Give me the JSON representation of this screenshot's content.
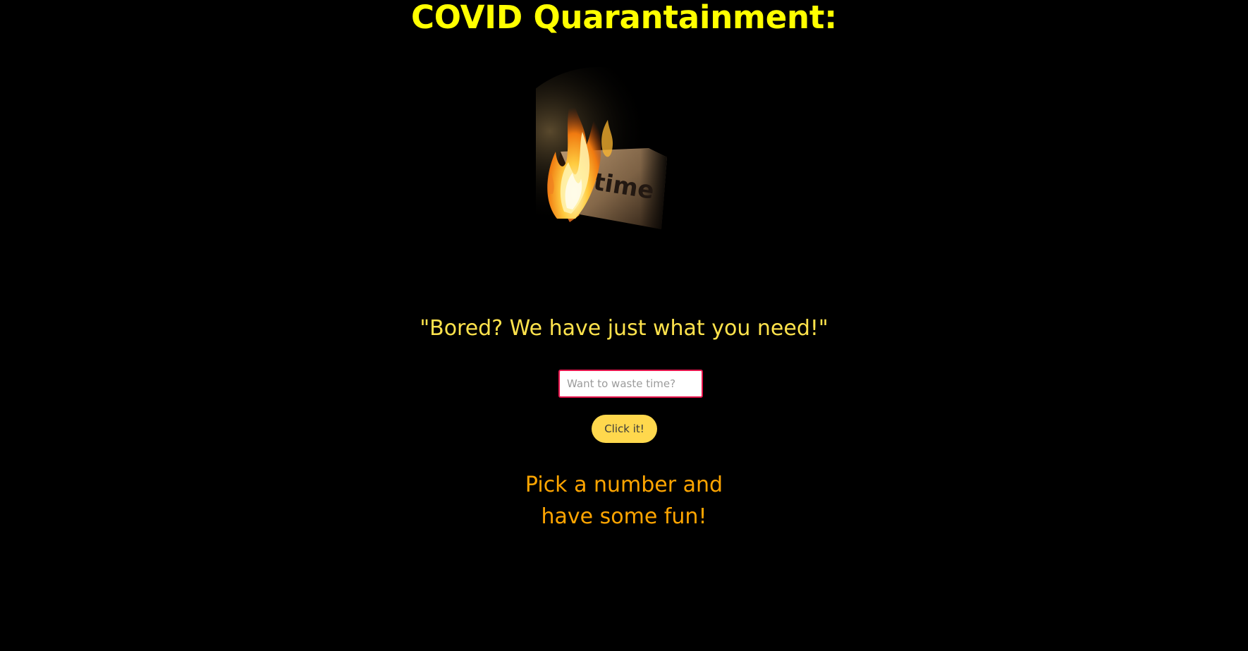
{
  "page": {
    "title": "COVID Quarantainment:",
    "image_text": "time",
    "tagline": "\"Bored? We have just what you need!\"",
    "input": {
      "placeholder": "Want to waste time?",
      "value": ""
    },
    "button_label": "Click it!",
    "result": {
      "line1": "Pick a number and",
      "line2": "have some fun!"
    }
  },
  "colors": {
    "background": "#000000",
    "title": "#ffff00",
    "tagline": "#ffe34c",
    "input_border": "#e6154d",
    "button": "#ffd84d",
    "result": "#ffa500"
  },
  "icons": {
    "hero_image": "burning-paper-time-image"
  }
}
